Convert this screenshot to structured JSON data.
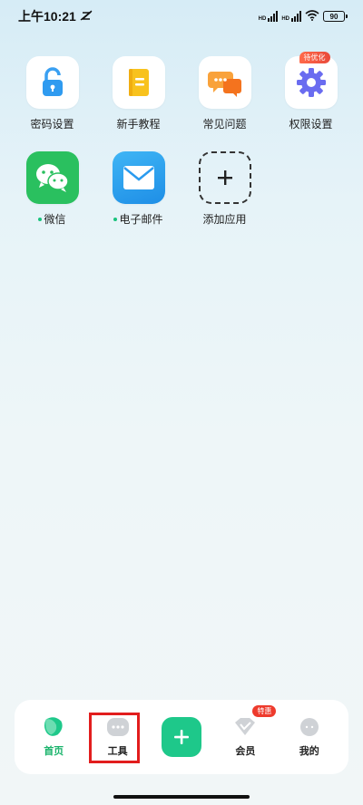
{
  "status_bar": {
    "time": "上午10:21",
    "network_label": "HD",
    "battery": "90"
  },
  "apps": [
    {
      "label": "密码设置",
      "icon": "lock-icon"
    },
    {
      "label": "新手教程",
      "icon": "notebook-icon"
    },
    {
      "label": "常见问题",
      "icon": "chat-bubbles-icon"
    },
    {
      "label": "权限设置",
      "icon": "gear-icon",
      "badge": "待优化"
    },
    {
      "label": "微信",
      "icon": "wechat-icon",
      "dot": true
    },
    {
      "label": "电子邮件",
      "icon": "mail-icon",
      "dot": true
    },
    {
      "label": "添加应用",
      "icon": "add-icon"
    }
  ],
  "bottom_nav": {
    "home": "首页",
    "tools": "工具",
    "vip": "会员",
    "vip_badge": "特惠",
    "mine": "我的"
  },
  "colors": {
    "accent": "#1ec88a",
    "highlight": "#e21d1d"
  }
}
